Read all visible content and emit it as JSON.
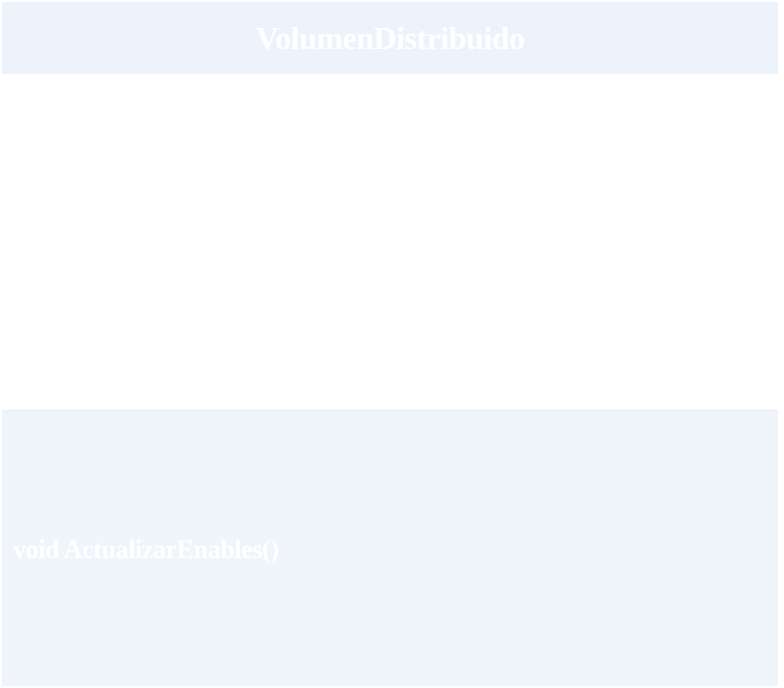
{
  "class": {
    "name": "VolumenDistribuido",
    "attributes": [],
    "methods": [
      "void ActualizarEnables()"
    ]
  },
  "colors": {
    "header_bg": "#ecf3fa",
    "methods_bg": "#eff5fa",
    "body_bg": "#ffffff",
    "text": "#ffffff"
  }
}
